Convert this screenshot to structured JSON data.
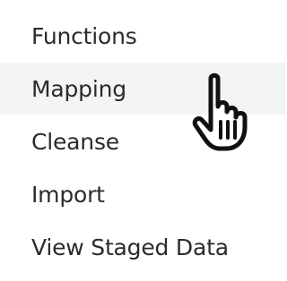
{
  "menu": {
    "items": [
      {
        "label": "Functions"
      },
      {
        "label": "Mapping"
      },
      {
        "label": "Cleanse"
      },
      {
        "label": "Import"
      },
      {
        "label": "View Staged Data"
      }
    ],
    "hovered_item": "Mapping"
  },
  "cursor": {
    "icon": "hand-pointer-icon"
  },
  "colors": {
    "background": "#ffffff",
    "hover_background": "#f3f4f6",
    "text": "#2b2b2b"
  }
}
